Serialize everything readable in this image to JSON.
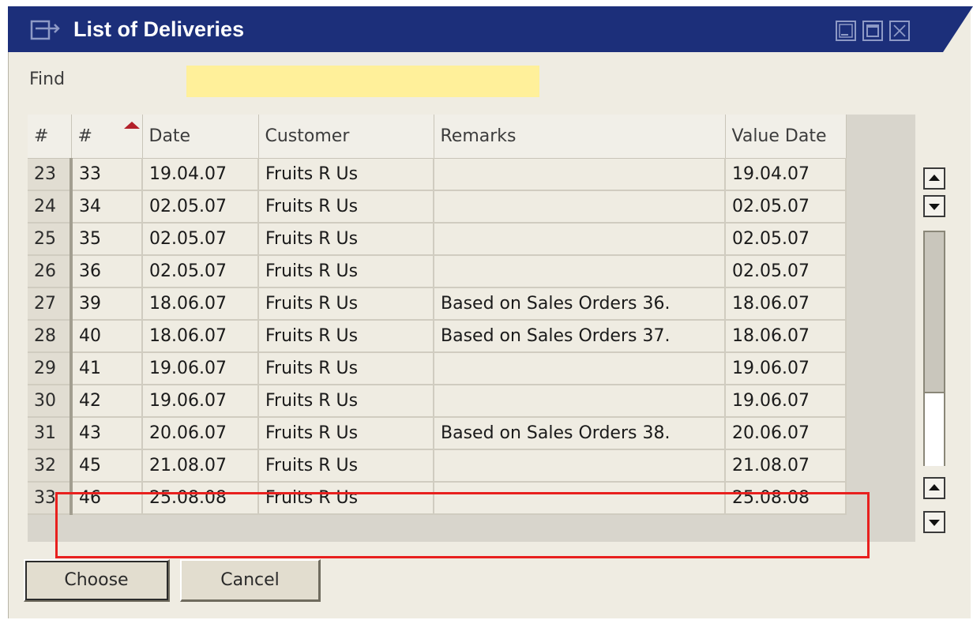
{
  "window": {
    "title": "List of Deliveries"
  },
  "find": {
    "label": "Find",
    "value": ""
  },
  "grid": {
    "sort_column": "#",
    "headers": {
      "row_number": "#",
      "doc_number": "#",
      "date": "Date",
      "customer": "Customer",
      "remarks": "Remarks",
      "value_date": "Value Date"
    },
    "rows": [
      {
        "row": "23",
        "num": "33",
        "date": "19.04.07",
        "customer": "Fruits R Us",
        "remarks": "",
        "value_date": "19.04.07"
      },
      {
        "row": "24",
        "num": "34",
        "date": "02.05.07",
        "customer": "Fruits R Us",
        "remarks": "",
        "value_date": "02.05.07"
      },
      {
        "row": "25",
        "num": "35",
        "date": "02.05.07",
        "customer": "Fruits R Us",
        "remarks": "",
        "value_date": "02.05.07"
      },
      {
        "row": "26",
        "num": "36",
        "date": "02.05.07",
        "customer": "Fruits R Us",
        "remarks": "",
        "value_date": "02.05.07"
      },
      {
        "row": "27",
        "num": "39",
        "date": "18.06.07",
        "customer": "Fruits R Us",
        "remarks": "Based on Sales Orders 36.",
        "value_date": "18.06.07"
      },
      {
        "row": "28",
        "num": "40",
        "date": "18.06.07",
        "customer": "Fruits R Us",
        "remarks": "Based on Sales Orders 37.",
        "value_date": "18.06.07"
      },
      {
        "row": "29",
        "num": "41",
        "date": "19.06.07",
        "customer": "Fruits R Us",
        "remarks": "",
        "value_date": "19.06.07"
      },
      {
        "row": "30",
        "num": "42",
        "date": "19.06.07",
        "customer": "Fruits R Us",
        "remarks": "",
        "value_date": "19.06.07"
      },
      {
        "row": "31",
        "num": "43",
        "date": "20.06.07",
        "customer": "Fruits R Us",
        "remarks": "Based on Sales Orders 38.",
        "value_date": "20.06.07"
      },
      {
        "row": "32",
        "num": "45",
        "date": "21.08.07",
        "customer": "Fruits R Us",
        "remarks": "",
        "value_date": "21.08.07"
      },
      {
        "row": "33",
        "num": "46",
        "date": "25.08.08",
        "customer": "Fruits R Us",
        "remarks": "",
        "value_date": "25.08.08"
      }
    ]
  },
  "buttons": {
    "choose": "Choose",
    "cancel": "Cancel"
  },
  "colors": {
    "titlebar": "#1c2f7a",
    "find_field": "#fff09a",
    "highlight_box": "#e8201e",
    "sort_arrow": "#b3202a"
  },
  "icons": {
    "window_icon": "form-icon",
    "minimize": "minimize-icon",
    "maximize": "maximize-icon",
    "close": "close-icon",
    "scroll_up": "arrow-up-icon",
    "scroll_down": "arrow-down-icon",
    "sort": "sort-arrow-icon"
  }
}
